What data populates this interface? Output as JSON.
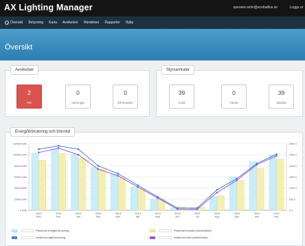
{
  "app": {
    "title": "AX Lighting Manager",
    "user": "operator.axlm@acobiaflux.se",
    "logout": "Logga ut"
  },
  "nav": [
    {
      "label": "Översikt",
      "icon": "dashboard-icon"
    },
    {
      "label": "Belysning"
    },
    {
      "label": "Karta"
    },
    {
      "label": "Avvikelser"
    },
    {
      "label": "Händelser"
    },
    {
      "label": "Rapporter"
    },
    {
      "label": "Hjälp"
    }
  ],
  "page_title": "Översikt",
  "avvikelser": {
    "title": "Avvikelser",
    "cards": [
      {
        "value": "2",
        "label": "Fel",
        "color": "#d9534f"
      },
      {
        "value": "0",
        "label": "Varningar"
      },
      {
        "value": "0",
        "label": "Information"
      }
    ]
  },
  "styrcentraler": {
    "title": "Styrcentraler",
    "cards": [
      {
        "value": "39",
        "label": "Antal"
      },
      {
        "value": "0",
        "label": "Tända"
      },
      {
        "value": "39",
        "label": "Släckta"
      }
    ]
  },
  "chart_panel": {
    "title": "Energiförbrukning och brinntid"
  },
  "chart_data": {
    "type": "bar",
    "categories": [
      "2012\nNov",
      "2012\nDec",
      "2013\nJan",
      "2013\nFeb",
      "2013\nMar",
      "2013\nApr",
      "2013\nMaj",
      "2013\nJun",
      "2013\nJul",
      "2013\nAug",
      "2013\nSep",
      "2013\nOkt",
      "2013\nNov"
    ],
    "y_left": {
      "ticks": [
        "0 kWh",
        "20000 kWh",
        "40000 kWh",
        "60000 kWh",
        "80000 kWh",
        "100000 kWh",
        "120000 kWh"
      ],
      "lim": [
        0,
        120000
      ]
    },
    "y_right": {
      "ticks": [
        "0 h",
        "500 h",
        "1000 h",
        "1500 h",
        "2000 h",
        "2500 h",
        "3000 h"
      ],
      "lim": [
        0,
        3000
      ]
    },
    "series": [
      {
        "name": "Planerad energiförbrukning",
        "kind": "bar",
        "axis": "left",
        "color": "#c9edf9",
        "values": [
          102000,
          110000,
          101000,
          77000,
          65000,
          42000,
          20000,
          4000,
          3500,
          25000,
          60000,
          87000,
          100000
        ]
      },
      {
        "name": "Planerad brinntid (medelvärde)",
        "kind": "bar",
        "axis": "right",
        "color": "#f4eeb3",
        "values": [
          2250,
          2550,
          2350,
          1850,
          1450,
          1000,
          500,
          150,
          150,
          650,
          1350,
          1900,
          2300
        ]
      },
      {
        "name": "Avläst energiförbrukning",
        "kind": "line",
        "axis": "left",
        "color": "#4a7fd4",
        "values": [
          110000,
          116000,
          110000,
          80000,
          66000,
          45000,
          24000,
          4000,
          4000,
          37000,
          57000,
          84000,
          101000
        ]
      },
      {
        "name": "Avläst brinntid (medelvärde)",
        "kind": "line",
        "axis": "right",
        "color": "#9b59d0",
        "values": [
          2600,
          2800,
          2500,
          1850,
          1550,
          1050,
          550,
          50,
          50,
          800,
          1350,
          2050,
          2450
        ]
      }
    ]
  }
}
